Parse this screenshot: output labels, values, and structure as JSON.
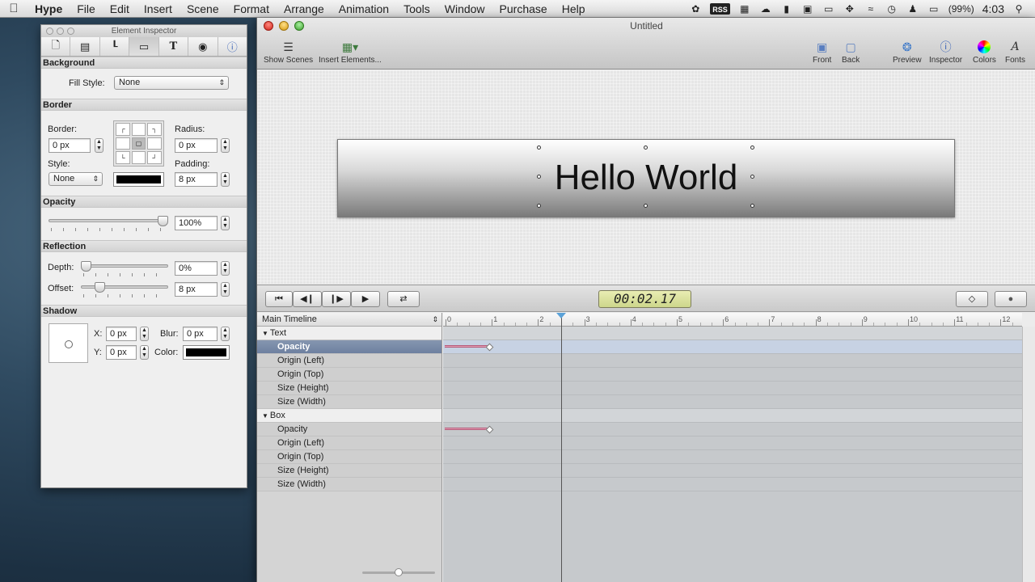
{
  "menubar": {
    "app_name": "Hype",
    "items": [
      "File",
      "Edit",
      "Insert",
      "Scene",
      "Format",
      "Arrange",
      "Animation",
      "Tools",
      "Window",
      "Purchase",
      "Help"
    ],
    "status": {
      "rss": "RSS",
      "battery": "(99%)",
      "time": "4:03"
    }
  },
  "inspector": {
    "title": "Element Inspector",
    "tabs": [
      "document-icon",
      "scene-icon",
      "metrics-icon",
      "element-icon",
      "text-icon",
      "actions-icon",
      "info-icon"
    ],
    "background": {
      "heading": "Background",
      "fill_label": "Fill Style:",
      "fill_value": "None"
    },
    "border": {
      "heading": "Border",
      "border_label": "Border:",
      "border_value": "0 px",
      "style_label": "Style:",
      "style_value": "None",
      "radius_label": "Radius:",
      "radius_value": "0 px",
      "padding_label": "Padding:",
      "padding_value": "8 px",
      "color": "#000000"
    },
    "opacity": {
      "heading": "Opacity",
      "value": "100%",
      "level": 1.0
    },
    "reflection": {
      "heading": "Reflection",
      "depth_label": "Depth:",
      "depth_value": "0%",
      "depth_level": 0.0,
      "offset_label": "Offset:",
      "offset_value": "8 px",
      "offset_level": 0.18
    },
    "shadow": {
      "heading": "Shadow",
      "x_label": "X:",
      "x_value": "0 px",
      "y_label": "Y:",
      "y_value": "0 px",
      "blur_label": "Blur:",
      "blur_value": "0 px",
      "color_label": "Color:",
      "color": "#000000"
    }
  },
  "window": {
    "title": "Untitled",
    "toolbar": {
      "show_scenes": "Show Scenes",
      "insert_elements": "Insert Elements...",
      "front": "Front",
      "back": "Back",
      "preview": "Preview",
      "inspector": "Inspector",
      "colors": "Colors",
      "fonts": "Fonts"
    },
    "scene_text": "Hello World"
  },
  "transport": {
    "timecode": "00:02.17"
  },
  "timeline": {
    "name": "Main Timeline",
    "groups": [
      {
        "name": "Text",
        "props": [
          "Opacity",
          "Origin (Left)",
          "Origin (Top)",
          "Size (Height)",
          "Size (Width)"
        ]
      },
      {
        "name": "Box",
        "props": [
          "Opacity",
          "Origin (Left)",
          "Origin (Top)",
          "Size (Height)",
          "Size (Width)"
        ]
      }
    ],
    "ruler": [
      "0",
      "1",
      "2",
      "3",
      "4",
      "5",
      "6",
      "7",
      "8",
      "9",
      "10",
      "11",
      "12"
    ],
    "playhead_seconds": 2.5
  }
}
